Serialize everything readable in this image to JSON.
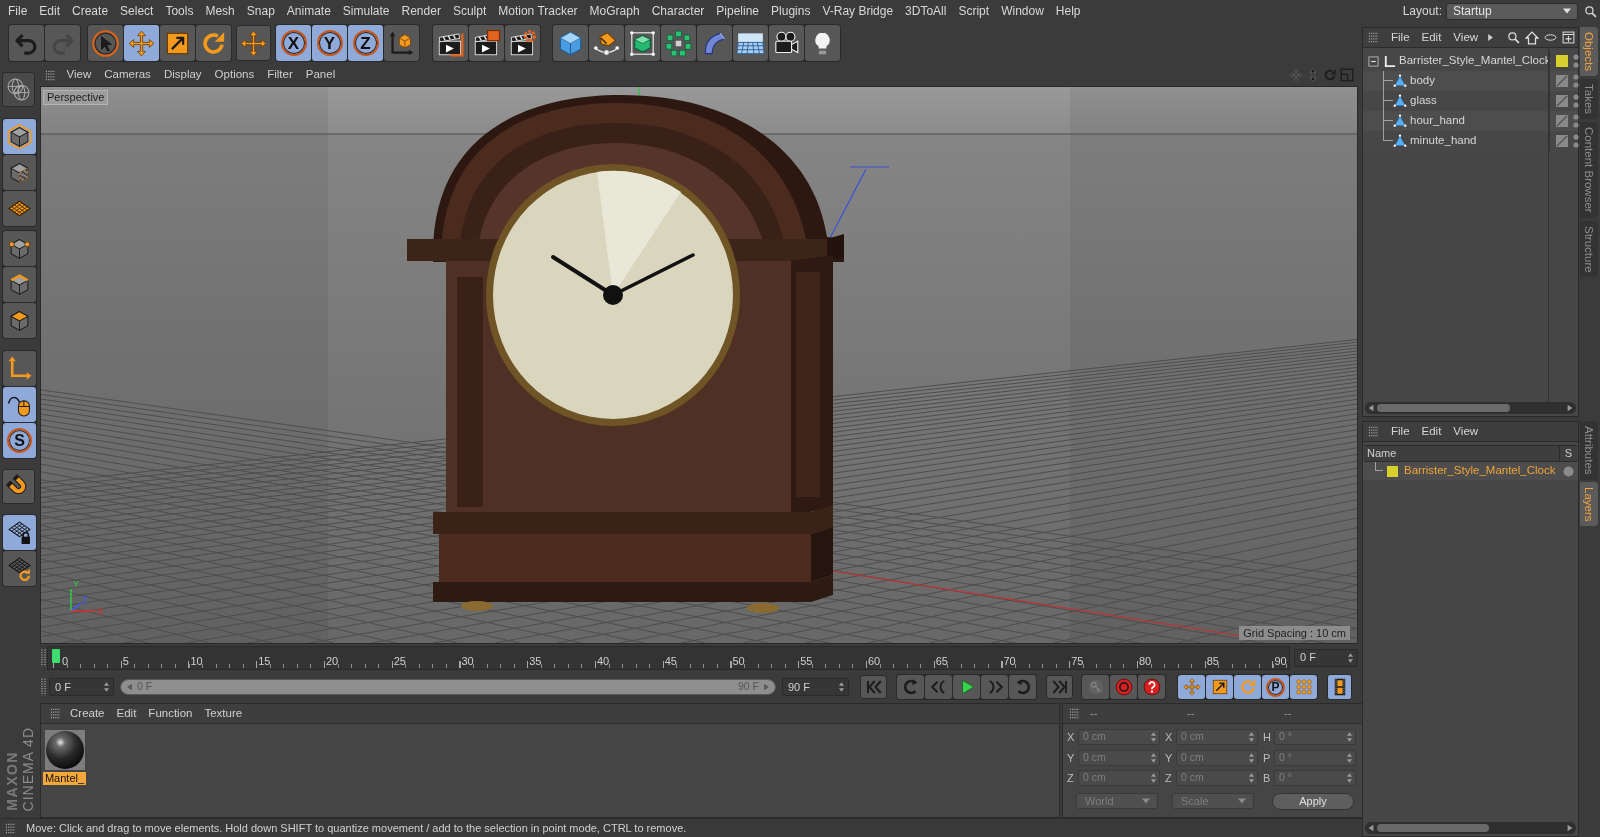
{
  "menu_bar": {
    "items": [
      "File",
      "Edit",
      "Create",
      "Select",
      "Tools",
      "Mesh",
      "Snap",
      "Animate",
      "Simulate",
      "Render",
      "Sculpt",
      "Motion Tracker",
      "MoGraph",
      "Character",
      "Pipeline",
      "Plugins",
      "V-Ray Bridge",
      "3DToAll",
      "Script",
      "Window",
      "Help"
    ],
    "layout_label": "Layout:",
    "layout_value": "Startup"
  },
  "toolbar": {
    "history": [
      {
        "kind": "undo",
        "disabled": false
      },
      {
        "kind": "redo",
        "disabled": true
      }
    ],
    "tool_groups": [
      [
        {
          "kind": "live-select",
          "selected": false
        },
        {
          "kind": "move",
          "selected": true
        },
        {
          "kind": "scale",
          "selected": false
        },
        {
          "kind": "rotate",
          "selected": false
        }
      ],
      [
        {
          "kind": "recent",
          "selected": false
        }
      ]
    ],
    "axes": [
      {
        "kind": "axis",
        "label": "X",
        "selected": true
      },
      {
        "kind": "axis",
        "label": "Y",
        "selected": true
      },
      {
        "kind": "axis",
        "label": "Z",
        "selected": true
      },
      {
        "kind": "coordinates",
        "selected": false
      }
    ],
    "render": [
      {
        "kind": "render-view"
      },
      {
        "kind": "render-picture"
      },
      {
        "kind": "render-settings"
      }
    ],
    "objects": [
      {
        "kind": "cube"
      },
      {
        "kind": "pen"
      },
      {
        "kind": "subdivision"
      },
      {
        "kind": "cloner"
      },
      {
        "kind": "bend"
      },
      {
        "kind": "floor"
      },
      {
        "kind": "camera"
      },
      {
        "kind": "light"
      }
    ]
  },
  "mode_toolbar": [
    [
      {
        "kind": "make-editable",
        "selected": false
      }
    ],
    [
      {
        "kind": "model",
        "selected": true
      },
      {
        "kind": "texture",
        "selected": false
      },
      {
        "kind": "workplane",
        "selected": false
      }
    ],
    [
      {
        "kind": "points",
        "selected": false
      },
      {
        "kind": "edges",
        "selected": false
      },
      {
        "kind": "polygons",
        "selected": false
      }
    ],
    [
      {
        "kind": "axis-mode",
        "selected": false
      },
      {
        "kind": "tweak",
        "selected": true
      },
      {
        "kind": "solo",
        "label": "S",
        "selected": true
      }
    ],
    [
      {
        "kind": "snap",
        "selected": false
      }
    ],
    [
      {
        "kind": "workplane-lock",
        "selected": true
      },
      {
        "kind": "workplane-rotate",
        "selected": false
      }
    ]
  ],
  "viewport": {
    "menu": [
      "View",
      "Cameras",
      "Display",
      "Options",
      "Filter",
      "Panel"
    ],
    "camera": "Perspective",
    "grid_spacing": "Grid Spacing : 10 cm",
    "gizmo_labels": [
      "Y",
      "Z",
      "X"
    ]
  },
  "object_manager": {
    "menu": [
      "File",
      "Edit",
      "View"
    ],
    "objects": [
      {
        "name": "Barrister_Style_Mantel_Clock",
        "kind": "null",
        "color": "#d8d02c",
        "expanded": true,
        "children": [
          {
            "name": "body",
            "kind": "polygon"
          },
          {
            "name": "glass",
            "kind": "polygon"
          },
          {
            "name": "hour_hand",
            "kind": "polygon"
          },
          {
            "name": "minute_hand",
            "kind": "polygon"
          }
        ]
      }
    ]
  },
  "layer_manager": {
    "menu": [
      "File",
      "Edit",
      "View"
    ],
    "columns": [
      "Name",
      "S"
    ],
    "layers": [
      {
        "name": "Barrister_Style_Mantel_Clock",
        "color": "#d8d02c"
      }
    ]
  },
  "side_tabs": {
    "top": [
      {
        "label": "Objects",
        "selected": true
      },
      {
        "label": "Takes",
        "selected": false
      },
      {
        "label": "Content Browser",
        "selected": false
      },
      {
        "label": "Structure",
        "selected": false
      }
    ],
    "bottom": [
      {
        "label": "Attributes",
        "selected": false
      },
      {
        "label": "Layers",
        "selected": true
      }
    ]
  },
  "timeline": {
    "ticks": [
      "0",
      "5",
      "10",
      "15",
      "20",
      "25",
      "30",
      "35",
      "40",
      "45",
      "50",
      "55",
      "60",
      "65",
      "70",
      "75",
      "80",
      "85",
      "90"
    ],
    "level": 0,
    "current_frame": "0 F"
  },
  "transport": {
    "start": "0 F",
    "range": {
      "start": "0 F",
      "end": "90 F",
      "level": 1
    },
    "end": "90 F",
    "playback": [
      [
        {
          "kind": "go-start"
        }
      ],
      [
        {
          "kind": "prev-key"
        },
        {
          "kind": "prev-frame"
        },
        {
          "kind": "play"
        },
        {
          "kind": "next-frame"
        },
        {
          "kind": "next-key"
        }
      ],
      [
        {
          "kind": "go-end"
        }
      ]
    ],
    "record": [
      {
        "kind": "key-selection",
        "disabled": true
      },
      {
        "kind": "record",
        "disabled": false
      },
      {
        "kind": "autokey",
        "disabled": false
      }
    ],
    "key_tracks": [
      {
        "kind": "move",
        "selected": true
      },
      {
        "kind": "scale",
        "selected": true
      },
      {
        "kind": "rotate",
        "selected": true
      },
      {
        "kind": "param",
        "label": "P",
        "selected": true
      },
      {
        "kind": "point-level",
        "selected": true
      }
    ],
    "timeline_button": {
      "kind": "timeline",
      "selected": true
    }
  },
  "material_manager": {
    "menu": [
      "Create",
      "Edit",
      "Function",
      "Texture"
    ],
    "materials": [
      {
        "name": "Mantel_",
        "selected": true
      }
    ]
  },
  "coordinates": {
    "headers": [
      "--",
      "--",
      "--"
    ],
    "disabled": true,
    "columns": [
      [
        {
          "axis": "X",
          "value": "0 cm"
        },
        {
          "axis": "Y",
          "value": "0 cm"
        },
        {
          "axis": "Z",
          "value": "0 cm"
        }
      ],
      [
        {
          "axis": "X",
          "value": "0 cm"
        },
        {
          "axis": "Y",
          "value": "0 cm"
        },
        {
          "axis": "Z",
          "value": "0 cm"
        }
      ],
      [
        {
          "axis": "H",
          "value": "0 °"
        },
        {
          "axis": "P",
          "value": "0 °"
        },
        {
          "axis": "B",
          "value": "0 °"
        }
      ]
    ],
    "mode": "World",
    "size_mode": "Scale",
    "apply": "Apply"
  },
  "logo": {
    "brand": "MAXON",
    "product": "CINEMA 4D"
  },
  "status_bar": {
    "text": "Move: Click and drag to move elements. Hold down SHIFT to quantize movement / add to the selection in point mode, CTRL to remove."
  }
}
